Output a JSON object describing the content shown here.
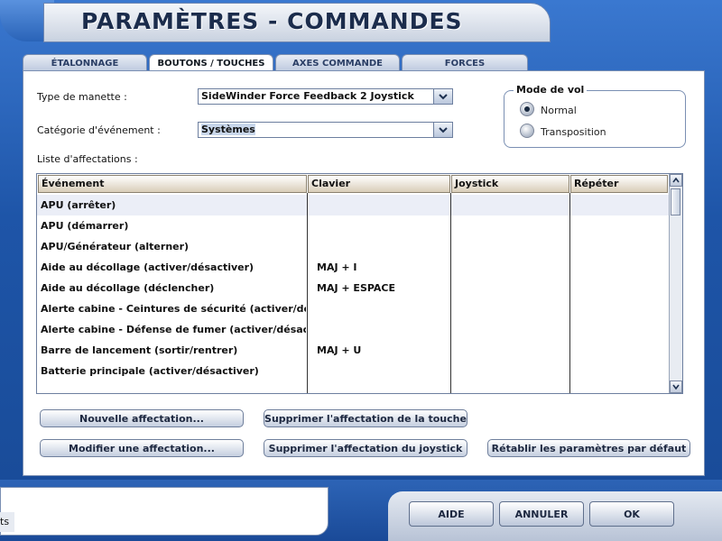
{
  "window": {
    "title": "PARAMÈTRES - COMMANDES"
  },
  "tabs": [
    {
      "label": "ÉTALONNAGE",
      "active": false
    },
    {
      "label": "BOUTONS / TOUCHES",
      "active": true
    },
    {
      "label": "AXES COMMANDE",
      "active": false
    },
    {
      "label": "FORCES",
      "active": false
    }
  ],
  "controller": {
    "label": "Type de manette :",
    "value": "SideWinder Force Feedback 2 Joystick"
  },
  "category": {
    "label": "Catégorie d'événement :",
    "value": "Systèmes"
  },
  "flight_mode": {
    "legend": "Mode de vol",
    "options": [
      {
        "label": "Normal",
        "selected": true
      },
      {
        "label": "Transposition",
        "selected": false
      }
    ]
  },
  "assignments": {
    "label": "Liste d'affectations :",
    "columns": [
      "Événement",
      "Clavier",
      "Joystick",
      "Répéter"
    ],
    "rows": [
      {
        "event": "APU (arrêter)",
        "keyboard": "",
        "joystick": "",
        "repeat": ""
      },
      {
        "event": "APU (démarrer)",
        "keyboard": "",
        "joystick": "",
        "repeat": ""
      },
      {
        "event": "APU/Générateur (alterner)",
        "keyboard": "",
        "joystick": "",
        "repeat": ""
      },
      {
        "event": "Aide au décollage (activer/désactiver)",
        "keyboard": "MAJ + I",
        "joystick": "",
        "repeat": ""
      },
      {
        "event": "Aide au décollage (déclencher)",
        "keyboard": "MAJ + ESPACE",
        "joystick": "",
        "repeat": ""
      },
      {
        "event": "Alerte cabine - Ceintures de sécurité (activer/désactiver)",
        "keyboard": "",
        "joystick": "",
        "repeat": ""
      },
      {
        "event": "Alerte cabine - Défense de fumer (activer/désactiver)",
        "keyboard": "",
        "joystick": "",
        "repeat": ""
      },
      {
        "event": "Barre de lancement (sortir/rentrer)",
        "keyboard": "MAJ + U",
        "joystick": "",
        "repeat": ""
      },
      {
        "event": "Batterie principale (activer/désactiver)",
        "keyboard": "",
        "joystick": "",
        "repeat": ""
      }
    ]
  },
  "actions": {
    "new": "Nouvelle affectation...",
    "modify": "Modifier une affectation...",
    "delete_key": "Supprimer l'affectation de la touche",
    "delete_joystick": "Supprimer l'affectation du joystick",
    "restore": "Rétablir les paramètres par défaut"
  },
  "footer": {
    "help": "AIDE",
    "cancel": "ANNULER",
    "ok": "OK",
    "taskbar_peek": "ts"
  }
}
